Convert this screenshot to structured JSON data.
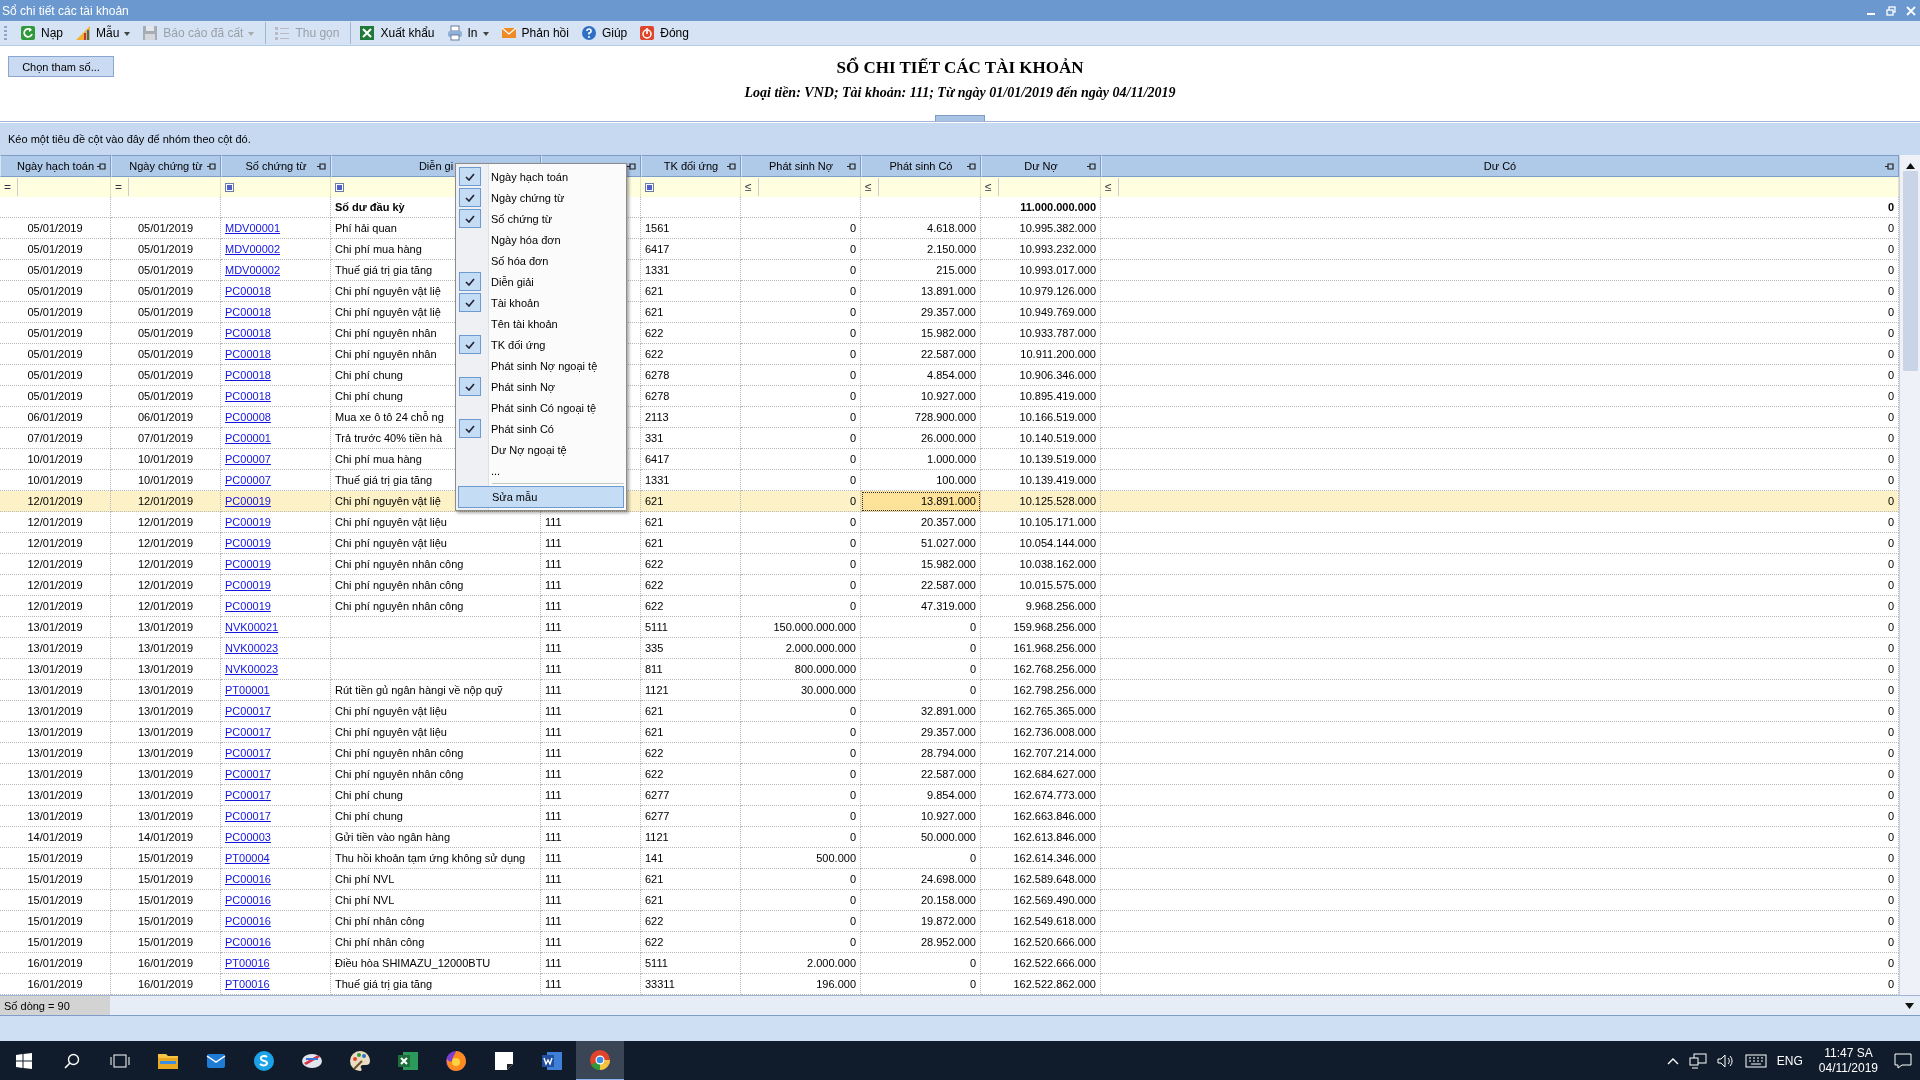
{
  "window": {
    "title": "Sổ chi tiết các tài khoản"
  },
  "toolbar": [
    {
      "kind": "reload",
      "label": "Nạp",
      "disabled": false,
      "dropdown": false,
      "separator_before": false
    },
    {
      "kind": "template",
      "label": "Mẫu",
      "disabled": false,
      "dropdown": true,
      "separator_before": false
    },
    {
      "kind": "save",
      "label": "Báo cáo đã cất",
      "disabled": true,
      "dropdown": true,
      "separator_before": false
    },
    {
      "kind": "collapse",
      "label": "Thu gọn",
      "disabled": true,
      "dropdown": false,
      "separator_before": true
    },
    {
      "kind": "excel",
      "label": "Xuất khẩu",
      "disabled": false,
      "dropdown": false,
      "separator_before": true
    },
    {
      "kind": "print",
      "label": "In",
      "disabled": false,
      "dropdown": true,
      "separator_before": false
    },
    {
      "kind": "mail",
      "label": "Phản hồi",
      "disabled": false,
      "dropdown": false,
      "separator_before": false
    },
    {
      "kind": "help",
      "label": "Giúp",
      "disabled": false,
      "dropdown": false,
      "separator_before": false
    },
    {
      "kind": "close",
      "label": "Đóng",
      "disabled": false,
      "dropdown": false,
      "separator_before": false
    }
  ],
  "report": {
    "params_button": "Chọn tham số...",
    "title": "SỔ CHI TIẾT CÁC TÀI KHOẢN",
    "subtitle": "Loại tiền: VND; Tài khoản: 111; Từ ngày 01/01/2019 đến ngày 04/11/2019"
  },
  "grid": {
    "group_panel": "Kéo một tiêu đề cột vào đây để nhóm theo cột đó.",
    "columns": [
      {
        "label": "Ngày hạch toán",
        "pin": true,
        "filter": {
          "kind": "operator",
          "symbol": "="
        }
      },
      {
        "label": "Ngày chứng từ",
        "pin": true,
        "filter": {
          "kind": "operator",
          "symbol": "="
        }
      },
      {
        "label": "Số chứng từ",
        "pin": true,
        "filter": {
          "kind": "square"
        }
      },
      {
        "label": "Diễn gi",
        "pin": false,
        "filter": {
          "kind": "square"
        }
      },
      {
        "pin": true
      },
      {
        "label": "TK đối ứng",
        "pin": true,
        "filter": {
          "kind": "square"
        }
      },
      {
        "label": "Phát sinh Nợ",
        "pin": true,
        "filter": {
          "kind": "operator",
          "symbol": "≤"
        }
      },
      {
        "label": "Phát sinh Có",
        "pin": true,
        "filter": {
          "kind": "operator",
          "symbol": "≤"
        }
      },
      {
        "label": "Dư Nợ",
        "pin": true,
        "filter": {
          "kind": "operator",
          "symbol": "≤"
        }
      },
      {
        "label": "Dư Có",
        "pin": true,
        "filter": {
          "kind": "operator",
          "symbol": "≤"
        }
      }
    ],
    "rows": [
      {
        "kind": "opening",
        "selected": false,
        "description": "Số dư đầu kỳ",
        "balance_debit": "11.000.000.000",
        "balance_credit": "0"
      },
      {
        "kind": "entry",
        "selected": false,
        "date_posted": "05/01/2019",
        "date_doc": "05/01/2019",
        "doc_no": "MDV00001",
        "description": "Phí hải quan",
        "contra_account": "1561",
        "debit": "0",
        "credit": "4.618.000",
        "balance_debit": "10.995.382.000",
        "balance_credit": "0"
      },
      {
        "kind": "entry",
        "selected": false,
        "date_posted": "05/01/2019",
        "date_doc": "05/01/2019",
        "doc_no": "MDV00002",
        "description": "Chi phí mua hàng",
        "contra_account": "6417",
        "debit": "0",
        "credit": "2.150.000",
        "balance_debit": "10.993.232.000",
        "balance_credit": "0"
      },
      {
        "kind": "entry",
        "selected": false,
        "date_posted": "05/01/2019",
        "date_doc": "05/01/2019",
        "doc_no": "MDV00002",
        "description": "Thuế giá trị gia tăng",
        "contra_account": "1331",
        "debit": "0",
        "credit": "215.000",
        "balance_debit": "10.993.017.000",
        "balance_credit": "0"
      },
      {
        "kind": "entry",
        "selected": false,
        "date_posted": "05/01/2019",
        "date_doc": "05/01/2019",
        "doc_no": "PC00018",
        "description": "Chi phí nguyên vật liệ",
        "contra_account": "621",
        "debit": "0",
        "credit": "13.891.000",
        "balance_debit": "10.979.126.000",
        "balance_credit": "0"
      },
      {
        "kind": "entry",
        "selected": false,
        "date_posted": "05/01/2019",
        "date_doc": "05/01/2019",
        "doc_no": "PC00018",
        "description": "Chi phí nguyên vật liệ",
        "contra_account": "621",
        "debit": "0",
        "credit": "29.357.000",
        "balance_debit": "10.949.769.000",
        "balance_credit": "0"
      },
      {
        "kind": "entry",
        "selected": false,
        "date_posted": "05/01/2019",
        "date_doc": "05/01/2019",
        "doc_no": "PC00018",
        "description": "Chi phí nguyên nhân",
        "contra_account": "622",
        "debit": "0",
        "credit": "15.982.000",
        "balance_debit": "10.933.787.000",
        "balance_credit": "0"
      },
      {
        "kind": "entry",
        "selected": false,
        "date_posted": "05/01/2019",
        "date_doc": "05/01/2019",
        "doc_no": "PC00018",
        "description": "Chi phí nguyên nhân",
        "contra_account": "622",
        "debit": "0",
        "credit": "22.587.000",
        "balance_debit": "10.911.200.000",
        "balance_credit": "0"
      },
      {
        "kind": "entry",
        "selected": false,
        "date_posted": "05/01/2019",
        "date_doc": "05/01/2019",
        "doc_no": "PC00018",
        "description": "Chi phí chung",
        "contra_account": "6278",
        "debit": "0",
        "credit": "4.854.000",
        "balance_debit": "10.906.346.000",
        "balance_credit": "0"
      },
      {
        "kind": "entry",
        "selected": false,
        "date_posted": "05/01/2019",
        "date_doc": "05/01/2019",
        "doc_no": "PC00018",
        "description": "Chi phí chung",
        "contra_account": "6278",
        "debit": "0",
        "credit": "10.927.000",
        "balance_debit": "10.895.419.000",
        "balance_credit": "0"
      },
      {
        "kind": "entry",
        "selected": false,
        "date_posted": "06/01/2019",
        "date_doc": "06/01/2019",
        "doc_no": "PC00008",
        "description": "Mua xe ô tô 24 chỗ ng",
        "contra_account": "2113",
        "debit": "0",
        "credit": "728.900.000",
        "balance_debit": "10.166.519.000",
        "balance_credit": "0"
      },
      {
        "kind": "entry",
        "selected": false,
        "date_posted": "07/01/2019",
        "date_doc": "07/01/2019",
        "doc_no": "PC00001",
        "description": "Trả trước 40% tiền hà",
        "contra_account": "331",
        "debit": "0",
        "credit": "26.000.000",
        "balance_debit": "10.140.519.000",
        "balance_credit": "0"
      },
      {
        "kind": "entry",
        "selected": false,
        "date_posted": "10/01/2019",
        "date_doc": "10/01/2019",
        "doc_no": "PC00007",
        "description": "Chi phí mua hàng",
        "contra_account": "6417",
        "debit": "0",
        "credit": "1.000.000",
        "balance_debit": "10.139.519.000",
        "balance_credit": "0"
      },
      {
        "kind": "entry",
        "selected": false,
        "date_posted": "10/01/2019",
        "date_doc": "10/01/2019",
        "doc_no": "PC00007",
        "description": "Thuế giá trị gia tăng",
        "contra_account": "1331",
        "debit": "0",
        "credit": "100.000",
        "balance_debit": "10.139.419.000",
        "balance_credit": "0"
      },
      {
        "kind": "entry",
        "selected": true,
        "credit_focused": true,
        "date_posted": "12/01/2019",
        "date_doc": "12/01/2019",
        "doc_no": "PC00019",
        "description": "Chi phí nguyên vật liệ",
        "contra_account": "621",
        "debit": "0",
        "credit": "13.891.000",
        "balance_debit": "10.125.528.000",
        "balance_credit": "0"
      },
      {
        "kind": "entry",
        "selected": false,
        "date_posted": "12/01/2019",
        "date_doc": "12/01/2019",
        "doc_no": "PC00019",
        "description": "Chi phí nguyên vật liệu",
        "account": "111",
        "contra_account": "621",
        "debit": "0",
        "credit": "20.357.000",
        "balance_debit": "10.105.171.000",
        "balance_credit": "0"
      },
      {
        "kind": "entry",
        "selected": false,
        "date_posted": "12/01/2019",
        "date_doc": "12/01/2019",
        "doc_no": "PC00019",
        "description": "Chi phí nguyên vật liệu",
        "account": "111",
        "contra_account": "621",
        "debit": "0",
        "credit": "51.027.000",
        "balance_debit": "10.054.144.000",
        "balance_credit": "0"
      },
      {
        "kind": "entry",
        "selected": false,
        "date_posted": "12/01/2019",
        "date_doc": "12/01/2019",
        "doc_no": "PC00019",
        "description": "Chi phí nguyên nhân công",
        "account": "111",
        "contra_account": "622",
        "debit": "0",
        "credit": "15.982.000",
        "balance_debit": "10.038.162.000",
        "balance_credit": "0"
      },
      {
        "kind": "entry",
        "selected": false,
        "date_posted": "12/01/2019",
        "date_doc": "12/01/2019",
        "doc_no": "PC00019",
        "description": "Chi phí nguyên nhân công",
        "account": "111",
        "contra_account": "622",
        "debit": "0",
        "credit": "22.587.000",
        "balance_debit": "10.015.575.000",
        "balance_credit": "0"
      },
      {
        "kind": "entry",
        "selected": false,
        "date_posted": "12/01/2019",
        "date_doc": "12/01/2019",
        "doc_no": "PC00019",
        "description": "Chi phí nguyên nhân công",
        "account": "111",
        "contra_account": "622",
        "debit": "0",
        "credit": "47.319.000",
        "balance_debit": "9.968.256.000",
        "balance_credit": "0"
      },
      {
        "kind": "entry",
        "selected": false,
        "date_posted": "13/01/2019",
        "date_doc": "13/01/2019",
        "doc_no": "NVK00021",
        "account": "111",
        "contra_account": "5111",
        "debit": "150.000.000.000",
        "credit": "0",
        "balance_debit": "159.968.256.000",
        "balance_credit": "0"
      },
      {
        "kind": "entry",
        "selected": false,
        "date_posted": "13/01/2019",
        "date_doc": "13/01/2019",
        "doc_no": "NVK00023",
        "account": "111",
        "contra_account": "335",
        "debit": "2.000.000.000",
        "credit": "0",
        "balance_debit": "161.968.256.000",
        "balance_credit": "0"
      },
      {
        "kind": "entry",
        "selected": false,
        "date_posted": "13/01/2019",
        "date_doc": "13/01/2019",
        "doc_no": "NVK00023",
        "account": "111",
        "contra_account": "811",
        "debit": "800.000.000",
        "credit": "0",
        "balance_debit": "162.768.256.000",
        "balance_credit": "0"
      },
      {
        "kind": "entry",
        "selected": false,
        "date_posted": "13/01/2019",
        "date_doc": "13/01/2019",
        "doc_no": "PT00001",
        "description": "Rút tiền gủ ngân hàngi về nộp quỹ",
        "account": "111",
        "contra_account": "1121",
        "debit": "30.000.000",
        "credit": "0",
        "balance_debit": "162.798.256.000",
        "balance_credit": "0"
      },
      {
        "kind": "entry",
        "selected": false,
        "date_posted": "13/01/2019",
        "date_doc": "13/01/2019",
        "doc_no": "PC00017",
        "description": "Chi phí nguyên vật liệu",
        "account": "111",
        "contra_account": "621",
        "debit": "0",
        "credit": "32.891.000",
        "balance_debit": "162.765.365.000",
        "balance_credit": "0"
      },
      {
        "kind": "entry",
        "selected": false,
        "date_posted": "13/01/2019",
        "date_doc": "13/01/2019",
        "doc_no": "PC00017",
        "description": "Chi phí nguyên vật liệu",
        "account": "111",
        "contra_account": "621",
        "debit": "0",
        "credit": "29.357.000",
        "balance_debit": "162.736.008.000",
        "balance_credit": "0"
      },
      {
        "kind": "entry",
        "selected": false,
        "date_posted": "13/01/2019",
        "date_doc": "13/01/2019",
        "doc_no": "PC00017",
        "description": "Chi phí nguyên nhân công",
        "account": "111",
        "contra_account": "622",
        "debit": "0",
        "credit": "28.794.000",
        "balance_debit": "162.707.214.000",
        "balance_credit": "0"
      },
      {
        "kind": "entry",
        "selected": false,
        "date_posted": "13/01/2019",
        "date_doc": "13/01/2019",
        "doc_no": "PC00017",
        "description": "Chi phí nguyên nhân công",
        "account": "111",
        "contra_account": "622",
        "debit": "0",
        "credit": "22.587.000",
        "balance_debit": "162.684.627.000",
        "balance_credit": "0"
      },
      {
        "kind": "entry",
        "selected": false,
        "date_posted": "13/01/2019",
        "date_doc": "13/01/2019",
        "doc_no": "PC00017",
        "description": "Chi phí chung",
        "account": "111",
        "contra_account": "6277",
        "debit": "0",
        "credit": "9.854.000",
        "balance_debit": "162.674.773.000",
        "balance_credit": "0"
      },
      {
        "kind": "entry",
        "selected": false,
        "date_posted": "13/01/2019",
        "date_doc": "13/01/2019",
        "doc_no": "PC00017",
        "description": "Chi phí chung",
        "account": "111",
        "contra_account": "6277",
        "debit": "0",
        "credit": "10.927.000",
        "balance_debit": "162.663.846.000",
        "balance_credit": "0"
      },
      {
        "kind": "entry",
        "selected": false,
        "date_posted": "14/01/2019",
        "date_doc": "14/01/2019",
        "doc_no": "PC00003",
        "description": "Gửi tiền vào ngân hàng",
        "account": "111",
        "contra_account": "1121",
        "debit": "0",
        "credit": "50.000.000",
        "balance_debit": "162.613.846.000",
        "balance_credit": "0"
      },
      {
        "kind": "entry",
        "selected": false,
        "date_posted": "15/01/2019",
        "date_doc": "15/01/2019",
        "doc_no": "PT00004",
        "description": "Thu hồi khoản tạm ứng không sử dụng",
        "account": "111",
        "contra_account": "141",
        "debit": "500.000",
        "credit": "0",
        "balance_debit": "162.614.346.000",
        "balance_credit": "0"
      },
      {
        "kind": "entry",
        "selected": false,
        "date_posted": "15/01/2019",
        "date_doc": "15/01/2019",
        "doc_no": "PC00016",
        "description": "Chi phí NVL",
        "account": "111",
        "contra_account": "621",
        "debit": "0",
        "credit": "24.698.000",
        "balance_debit": "162.589.648.000",
        "balance_credit": "0"
      },
      {
        "kind": "entry",
        "selected": false,
        "date_posted": "15/01/2019",
        "date_doc": "15/01/2019",
        "doc_no": "PC00016",
        "description": "Chi phí NVL",
        "account": "111",
        "contra_account": "621",
        "debit": "0",
        "credit": "20.158.000",
        "balance_debit": "162.569.490.000",
        "balance_credit": "0"
      },
      {
        "kind": "entry",
        "selected": false,
        "date_posted": "15/01/2019",
        "date_doc": "15/01/2019",
        "doc_no": "PC00016",
        "description": "Chi phí nhân công",
        "account": "111",
        "contra_account": "622",
        "debit": "0",
        "credit": "19.872.000",
        "balance_debit": "162.549.618.000",
        "balance_credit": "0"
      },
      {
        "kind": "entry",
        "selected": false,
        "date_posted": "15/01/2019",
        "date_doc": "15/01/2019",
        "doc_no": "PC00016",
        "description": "Chi phí nhân công",
        "account": "111",
        "contra_account": "622",
        "debit": "0",
        "credit": "28.952.000",
        "balance_debit": "162.520.666.000",
        "balance_credit": "0"
      },
      {
        "kind": "entry",
        "selected": false,
        "date_posted": "16/01/2019",
        "date_doc": "16/01/2019",
        "doc_no": "PT00016",
        "description": "Điều hòa SHIMAZU_12000BTU",
        "account": "111",
        "contra_account": "5111",
        "debit": "2.000.000",
        "credit": "0",
        "balance_debit": "162.522.666.000",
        "balance_credit": "0"
      },
      {
        "kind": "entry",
        "selected": false,
        "date_posted": "16/01/2019",
        "date_doc": "16/01/2019",
        "doc_no": "PT00016",
        "description": "Thuế giá trị gia tăng",
        "account": "111",
        "contra_account": "33311",
        "debit": "196.000",
        "credit": "0",
        "balance_debit": "162.522.862.000",
        "balance_credit": "0"
      }
    ],
    "status": "Số dòng = 90"
  },
  "column_menu": {
    "items": [
      {
        "label": "Ngày hạch toán",
        "checked": true
      },
      {
        "label": "Ngày chứng từ",
        "checked": true
      },
      {
        "label": "Số chứng từ",
        "checked": true
      },
      {
        "label": "Ngày hóa đơn",
        "checked": false
      },
      {
        "label": "Số hóa đơn",
        "checked": false
      },
      {
        "label": "Diễn giải",
        "checked": true
      },
      {
        "label": "Tài khoản",
        "checked": true
      },
      {
        "label": "Tên tài khoản",
        "checked": false
      },
      {
        "label": "TK đối ứng",
        "checked": true
      },
      {
        "label": "Phát sinh Nợ ngoại tệ",
        "checked": false
      },
      {
        "label": "Phát sinh Nợ",
        "checked": true
      },
      {
        "label": "Phát sinh Có ngoại tệ",
        "checked": false
      },
      {
        "label": "Phát sinh Có",
        "checked": true
      },
      {
        "label": "Dư Nợ ngoại tệ",
        "checked": false
      },
      {
        "label": "...",
        "checked": false
      }
    ],
    "footer": {
      "label": "Sửa mẫu",
      "hovered": true
    }
  },
  "taskbar": {
    "apps": [
      {
        "kind": "explorer",
        "active": false
      },
      {
        "kind": "mail",
        "active": false
      },
      {
        "kind": "skype",
        "active": false
      },
      {
        "kind": "paint3d",
        "active": false
      },
      {
        "kind": "paint",
        "active": false
      },
      {
        "kind": "excel",
        "active": false
      },
      {
        "kind": "firefox",
        "active": false
      },
      {
        "kind": "sticky",
        "active": false
      },
      {
        "kind": "word",
        "active": false
      },
      {
        "kind": "chrome",
        "active": true
      }
    ],
    "language": "ENG",
    "time": "11:47 SA",
    "date": "04/11/2019"
  }
}
